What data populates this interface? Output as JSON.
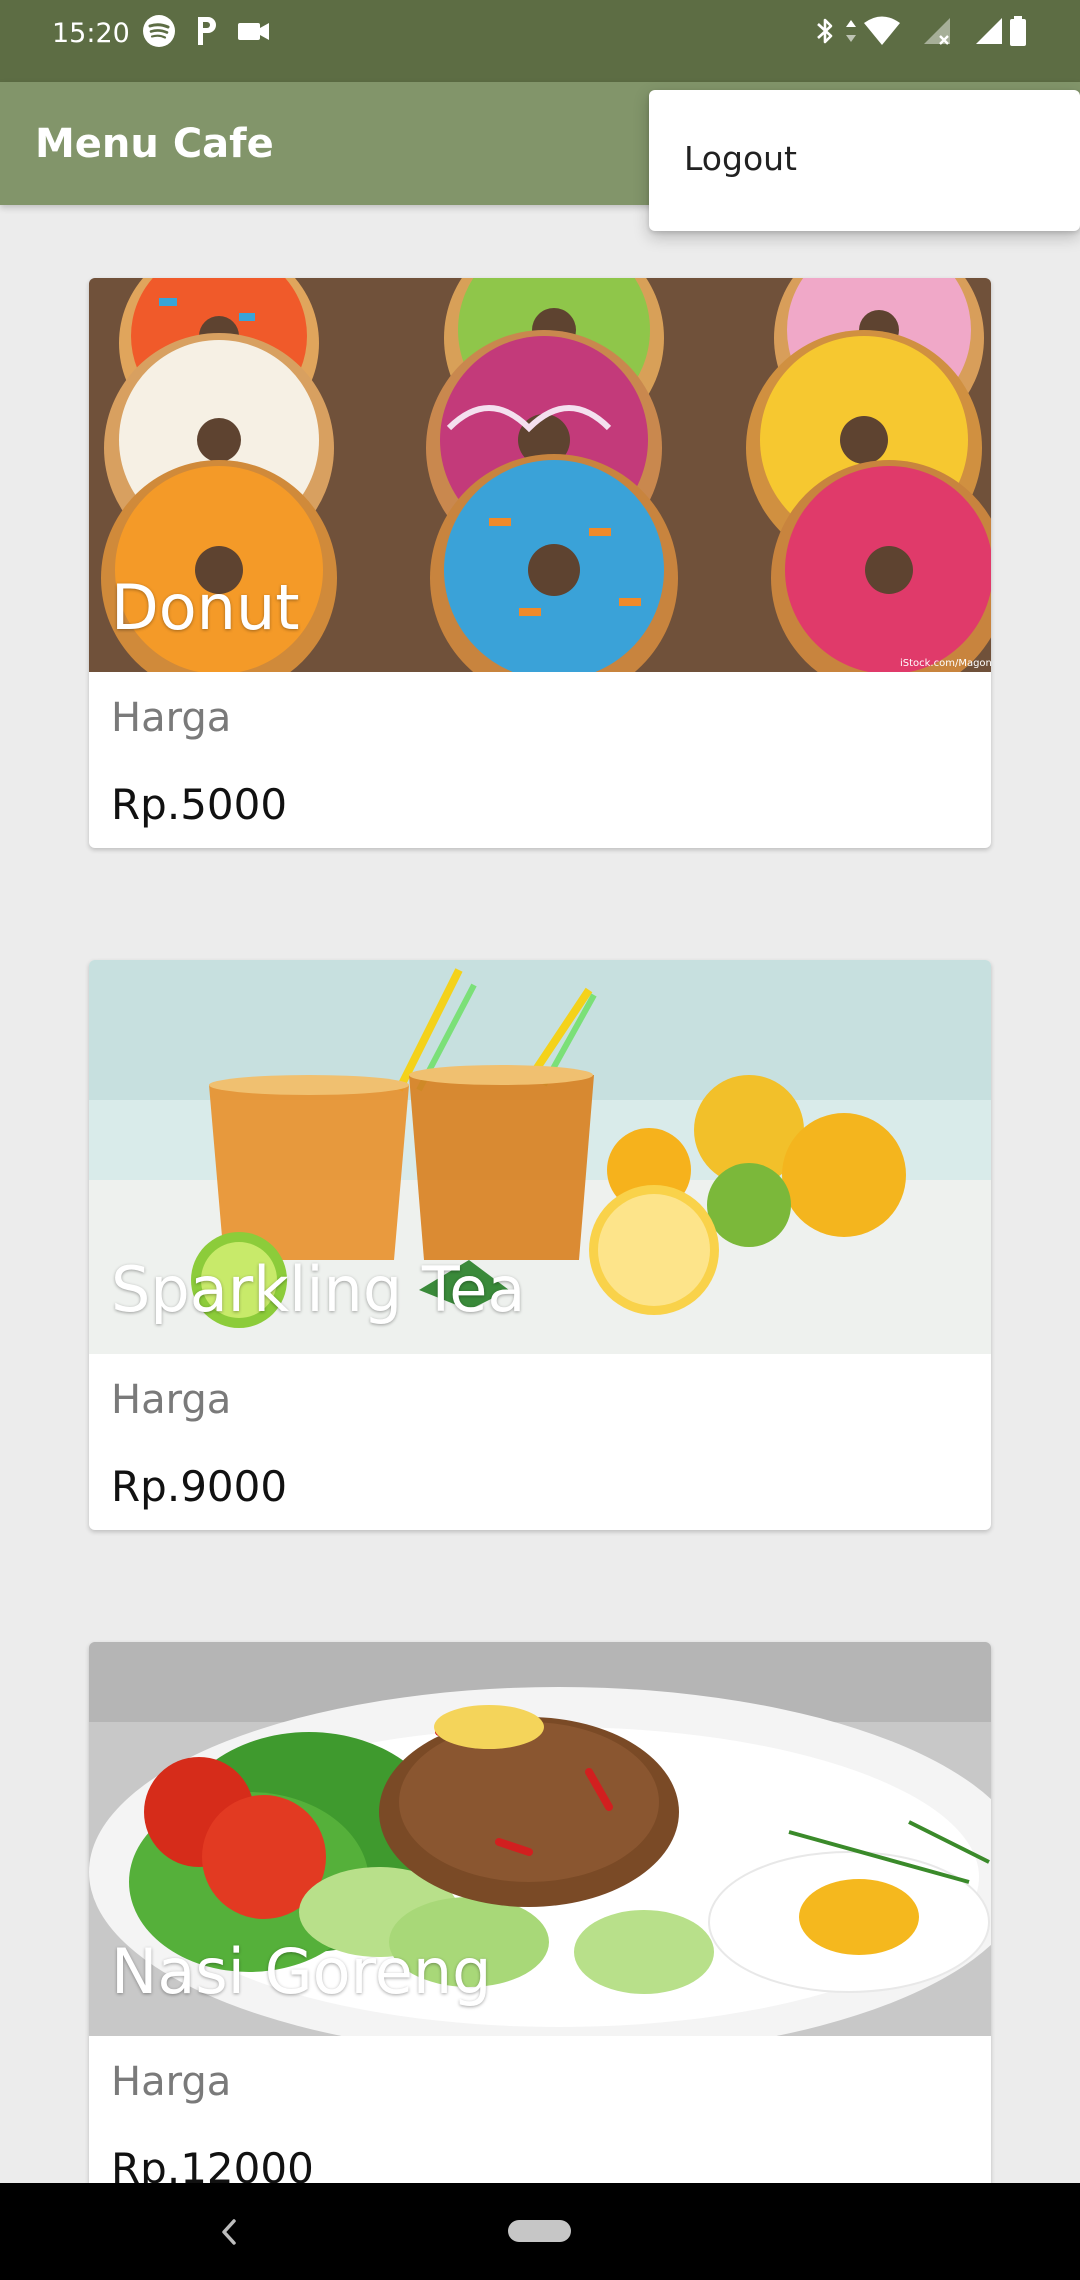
{
  "status_bar": {
    "time": "15:20",
    "left_icons": [
      "spotify-icon",
      "p-icon",
      "video-camera-icon"
    ],
    "right_icons": [
      "bluetooth-icon",
      "data-arrows-icon",
      "wifi-icon",
      "signal-icon",
      "signal-icon",
      "battery-icon"
    ]
  },
  "app_bar": {
    "title": "Menu Cafe",
    "color": "#82956a"
  },
  "overflow_menu": {
    "items": [
      {
        "label": "Logout"
      }
    ]
  },
  "menu_items": [
    {
      "name": "Donut",
      "price_label": "Harga",
      "price": "Rp.5000",
      "image": "donuts-photo",
      "image_credit": "iStock.com/Magone"
    },
    {
      "name": "Sparkling Tea",
      "price_label": "Harga",
      "price": "Rp.9000",
      "image": "iced-tea-photo"
    },
    {
      "name": "Nasi Goreng",
      "price_label": "Harga",
      "price": "Rp.12000",
      "image": "fried-rice-photo"
    }
  ],
  "nav_bar": {
    "icons": [
      "back-icon",
      "home-pill-icon"
    ]
  },
  "colors": {
    "status_bar": "#5d6d44",
    "background": "#ececec"
  }
}
